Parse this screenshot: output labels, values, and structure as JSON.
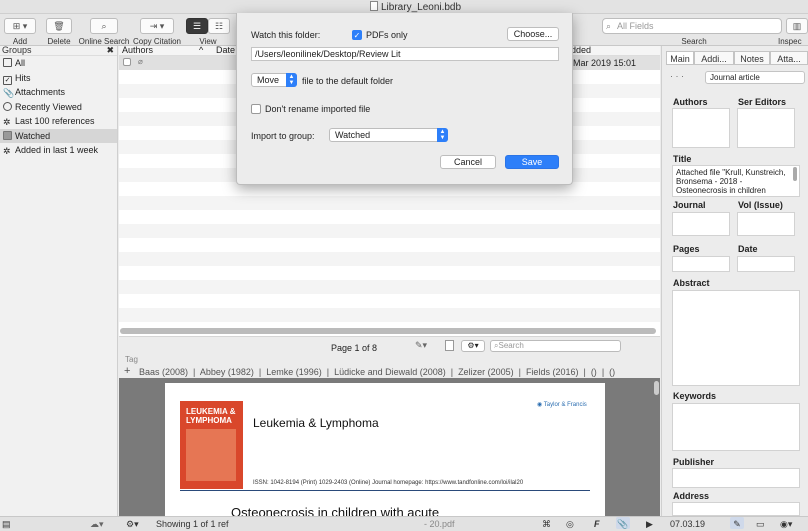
{
  "window": {
    "title": "Library_Leoni.bdb"
  },
  "toolbar": {
    "add_label": "Add",
    "delete_label": "Delete",
    "online_search_label": "Online Search",
    "copy_citation_label": "Copy Citation",
    "view_label": "View",
    "search_label": "Search",
    "inspector_label": "Inspec",
    "search_placeholder": "All Fields"
  },
  "sidebar": {
    "header": "Groups",
    "items": [
      {
        "label": "All"
      },
      {
        "label": "Hits"
      },
      {
        "label": "Attachments"
      },
      {
        "label": "Recently Viewed"
      },
      {
        "label": "Last 100 references"
      },
      {
        "label": "Watched"
      },
      {
        "label": "Added in last 1 week"
      }
    ]
  },
  "reflist": {
    "columns": {
      "authors": "Authors",
      "date": "Date",
      "added": "dded"
    },
    "row_added": "Mar 2019 15:01"
  },
  "pdfbar": {
    "page_indicator": "Page 1 of 8",
    "search_placeholder": "Search",
    "tag_label": "Tag",
    "tags": [
      "Baas (2008)",
      "Abbey (1982)",
      "Lemke (1996)",
      "Lüdicke and Diewald (2008)",
      "Zelizer (2005)",
      "Fields (2016)",
      "()",
      "()"
    ]
  },
  "pdf": {
    "journal_title": "Leukemia & Lymphoma",
    "cover_line1": "LEUKEMIA &",
    "cover_line2": "LYMPHOMA",
    "publisher": "Taylor & Francis",
    "issn_line": "ISSN: 1042-8194 (Print) 1029-2403 (Online) Journal homepage: https://www.tandfonline.com/loi/ilal20",
    "article_title": "Osteonecrosis in children with acute"
  },
  "rpanel": {
    "tabs": [
      "Main",
      "Addi...",
      "Notes",
      "Atta..."
    ],
    "type_value": "Journal article",
    "authors_label": "Authors",
    "ser_editors_label": "Ser Editors",
    "title_label": "Title",
    "title_value": "Attached file \"Krull, Kunstreich, Bronsema - 2018 - Osteonecrosis in children",
    "journal_label": "Journal",
    "vol_label": "Vol (Issue)",
    "pages_label": "Pages",
    "date_label": "Date",
    "abstract_label": "Abstract",
    "keywords_label": "Keywords",
    "publisher_label": "Publisher",
    "address_label": "Address"
  },
  "status": {
    "showing": "Showing 1 of 1 ref",
    "filename": "- 20.pdf",
    "date": "07.03.19"
  },
  "modal": {
    "watch_label": "Watch this folder:",
    "pdfs_only_label": "PDFs only",
    "pdfs_only_checked": true,
    "choose_label": "Choose...",
    "folder_path": "/Users/leonilinek/Desktop/Review Lit",
    "action_value": "Move",
    "action_suffix": "file to the default folder",
    "dont_rename_label": "Don't rename imported file",
    "import_group_label": "Import to group:",
    "import_group_value": "Watched",
    "cancel_label": "Cancel",
    "save_label": "Save"
  },
  "colors": {
    "accent": "#2d7ff9",
    "cover": "#d9472b"
  }
}
